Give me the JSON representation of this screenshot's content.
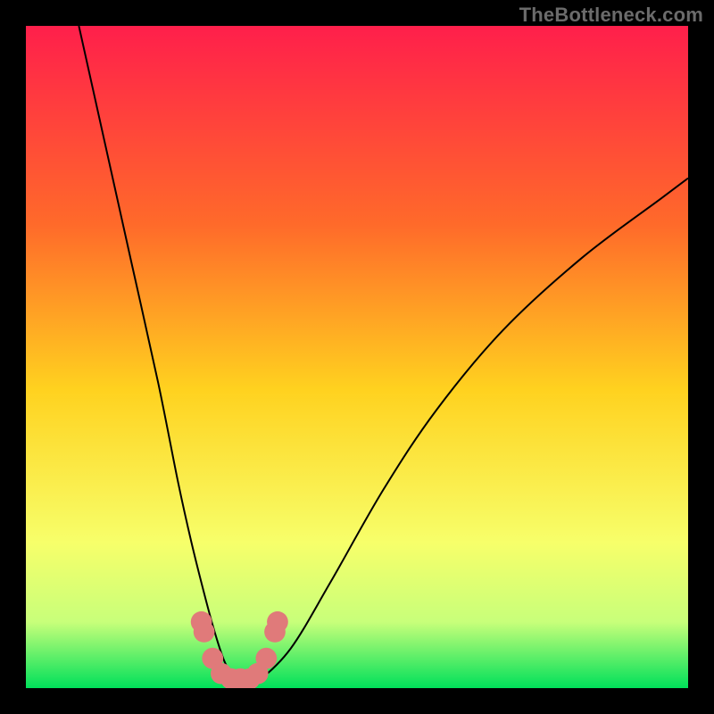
{
  "watermark": "TheBottleneck.com",
  "chart_data": {
    "type": "line",
    "title": "",
    "xlabel": "",
    "ylabel": "",
    "xlim": [
      0,
      100
    ],
    "ylim": [
      0,
      100
    ],
    "gradient_stops": [
      {
        "offset": 0,
        "color": "#ff1f4b"
      },
      {
        "offset": 0.3,
        "color": "#ff6a2a"
      },
      {
        "offset": 0.55,
        "color": "#ffd21f"
      },
      {
        "offset": 0.78,
        "color": "#f7ff6a"
      },
      {
        "offset": 0.9,
        "color": "#c8ff7a"
      },
      {
        "offset": 1.0,
        "color": "#00e05a"
      }
    ],
    "series": [
      {
        "name": "curve",
        "stroke": "#000000",
        "x": [
          8,
          12,
          16,
          20,
          23,
          25,
          27,
          28.5,
          30,
          31.5,
          33,
          35,
          40,
          46,
          54,
          62,
          72,
          84,
          96,
          100
        ],
        "y": [
          100,
          82,
          64,
          46,
          31,
          22,
          14,
          8.5,
          4,
          1.6,
          0.6,
          1.0,
          6,
          16,
          30,
          42,
          54,
          65,
          74,
          77
        ]
      }
    ],
    "markers": {
      "color": "#e07a7a",
      "radius": 1.6,
      "points": [
        {
          "x": 26.5,
          "y": 10
        },
        {
          "x": 26.9,
          "y": 8.5
        },
        {
          "x": 28.2,
          "y": 4.5
        },
        {
          "x": 29.5,
          "y": 2.2
        },
        {
          "x": 31.0,
          "y": 1.4
        },
        {
          "x": 32.4,
          "y": 1.4
        },
        {
          "x": 33.8,
          "y": 1.4
        },
        {
          "x": 35.0,
          "y": 2.2
        },
        {
          "x": 36.3,
          "y": 4.5
        },
        {
          "x": 37.6,
          "y": 8.5
        },
        {
          "x": 38.0,
          "y": 10
        }
      ]
    }
  }
}
